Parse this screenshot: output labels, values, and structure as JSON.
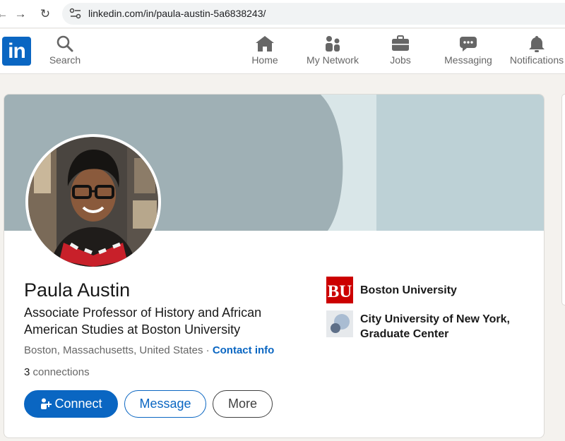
{
  "browser": {
    "url": "linkedin.com/in/paula-austin-5a6838243/"
  },
  "nav": {
    "logo_text": "in",
    "search": "Search",
    "home": "Home",
    "my_network": "My Network",
    "jobs": "Jobs",
    "messaging": "Messaging",
    "notifications": "Notifications"
  },
  "profile": {
    "name": "Paula Austin",
    "headline": "Associate Professor of History and African American Studies at Boston University",
    "location": "Boston, Massachusetts, United States",
    "separator": " · ",
    "contact_info": "Contact info",
    "connections_count": "3",
    "connections_label": " connections"
  },
  "actions": {
    "connect": "Connect",
    "message": "Message",
    "more": "More"
  },
  "education": [
    {
      "name": "Boston University",
      "logo_text": "BU"
    },
    {
      "name": "City University of New York, Graduate Center"
    }
  ],
  "colors": {
    "brand": "#0a66c2",
    "banner_dark": "#9fb0b5",
    "banner_light": "#bdd1d6",
    "bu_red": "#cc0000"
  }
}
